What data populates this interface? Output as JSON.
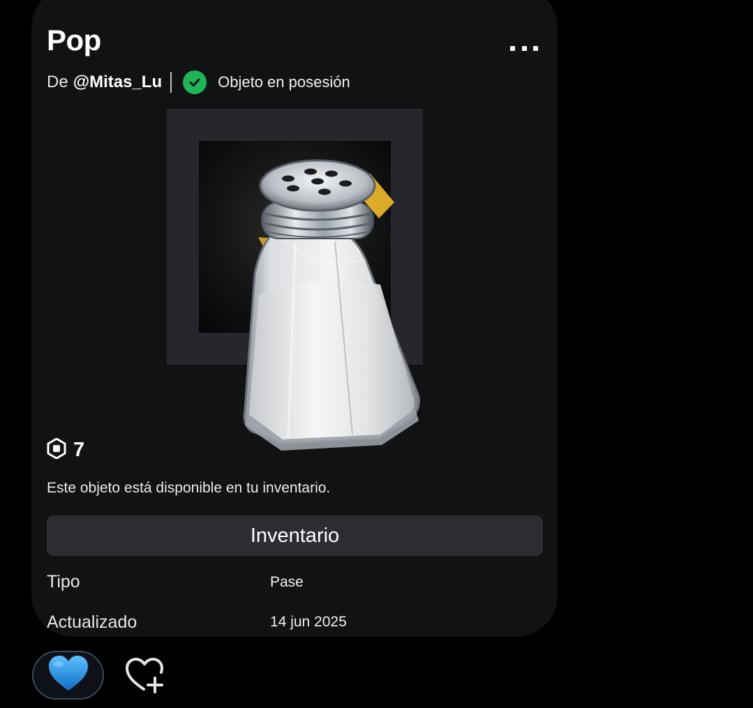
{
  "item": {
    "title": "Pop",
    "by_prefix": "De",
    "creator": "@Mitas_Lu",
    "owned_status": "Objeto en posesión",
    "image_icon": "salt-shaker-image",
    "price_icon": "robux-icon",
    "price": "7",
    "availability_text": "Este objeto está disponible en tu inventario.",
    "inventory_button_label": "Inventario"
  },
  "details": {
    "type_label": "Tipo",
    "type_value": "Pase",
    "updated_label": "Actualizado",
    "updated_value": "14 jun 2025"
  },
  "actions": {
    "more_icon": "more-options-icon",
    "favorite_icon": "blue-heart-icon",
    "follow_icon": "heart-plus-icon"
  },
  "colors": {
    "owned_green": "#1fb457",
    "card_background": "#111214",
    "button_background": "#2b2d33",
    "heart_blue": "#1a8fe3"
  }
}
